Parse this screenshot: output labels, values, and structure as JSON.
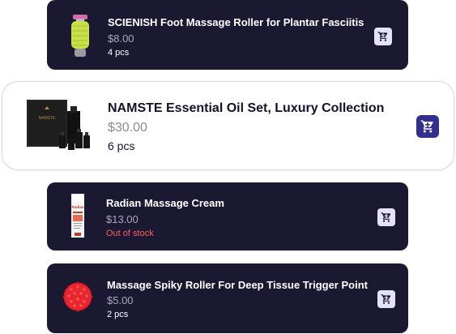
{
  "colors": {
    "card_dark": "#1b1832",
    "card_light": "#ffffff",
    "cart_button_light": "#e4e1fb",
    "cart_button_primary": "#322f8e",
    "out_of_stock": "#ff5c5c",
    "price_muted": "#a9a8bb"
  },
  "products": [
    {
      "title": "SCIENISH Foot Massage Roller for Plantar Fasciitis",
      "price": "$8.00",
      "stock": "4 pcs",
      "icon": "cart-icon",
      "thumbnail": "foot-roller-image"
    },
    {
      "title": "NAMSTE Essential Oil Set, Luxury Collection",
      "price": "$30.00",
      "stock": "6 pcs",
      "icon": "cart-icon",
      "thumbnail": "essential-oil-set-image",
      "box_logo_text": "NAMSTE"
    },
    {
      "title": "Radian Massage Cream",
      "price": "$13.00",
      "stock": "Out of stock",
      "icon": "cart-icon",
      "thumbnail": "massage-cream-image",
      "tube_brand_text": "Radian"
    },
    {
      "title": "Massage Spiky Roller For Deep Tissue Trigger Point",
      "price": "$5.00",
      "stock": "2 pcs",
      "icon": "cart-icon",
      "thumbnail": "spiky-ball-image"
    }
  ]
}
